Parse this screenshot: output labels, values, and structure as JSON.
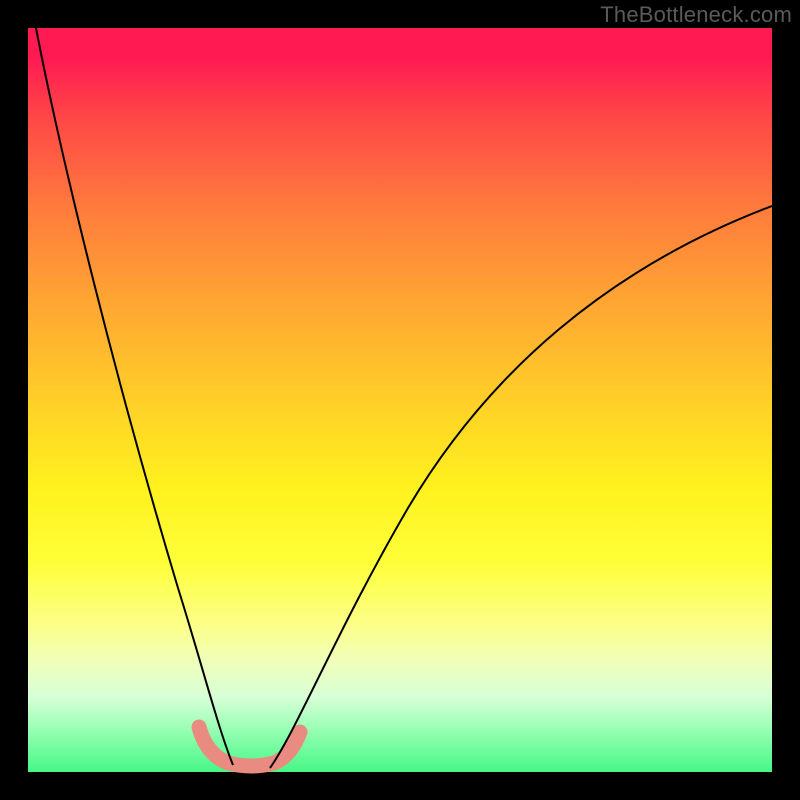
{
  "watermark": {
    "text": "TheBottleneck.com"
  },
  "chart_data": {
    "type": "line",
    "title": "",
    "xlabel": "",
    "ylabel": "",
    "xlim": [
      0,
      100
    ],
    "ylim": [
      0,
      100
    ],
    "series": [
      {
        "name": "left-curve",
        "x": [
          1,
          4,
          8,
          12,
          16,
          20,
          23,
          25,
          27
        ],
        "y": [
          100,
          84,
          66,
          48,
          31,
          15,
          5,
          1,
          0
        ]
      },
      {
        "name": "right-curve",
        "x": [
          33,
          35,
          38,
          42,
          48,
          56,
          66,
          78,
          90,
          100
        ],
        "y": [
          0,
          2,
          6,
          13,
          24,
          37,
          50,
          61,
          70,
          76
        ]
      },
      {
        "name": "highlight-band",
        "x": [
          23,
          25,
          27,
          30,
          33,
          35,
          36.5
        ],
        "y": [
          6,
          2,
          0.5,
          0,
          0.5,
          2,
          5
        ]
      }
    ],
    "background_gradient": {
      "top": "#ff1a52",
      "bottom": "#46f787"
    }
  }
}
